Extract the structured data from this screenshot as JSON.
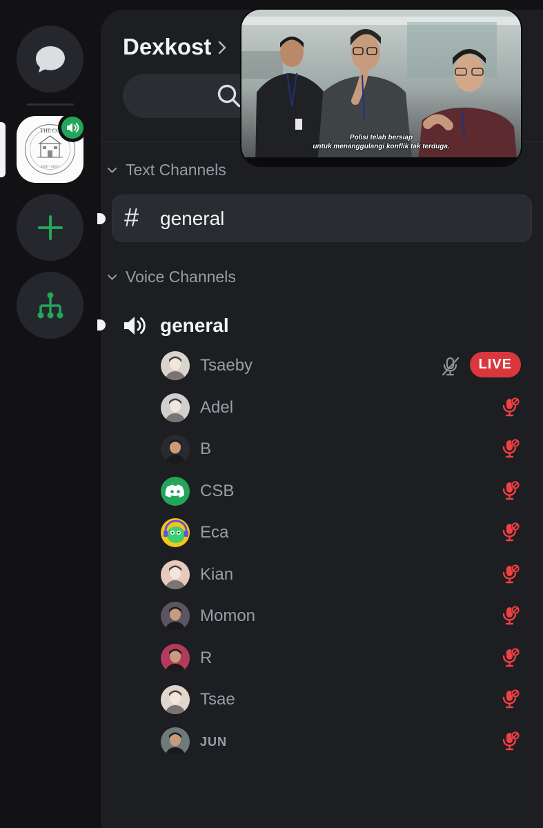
{
  "server": {
    "name": "Dexkost",
    "icon_caption_top": "THE CO",
    "icon_caption_bottom": "EST • 2017"
  },
  "stream_preview": {
    "subtitle_line1": "Polisi telah bersiap",
    "subtitle_line2": "untuk menanggulangi konflik tak terduga."
  },
  "categories": {
    "text": "Text Channels",
    "voice": "Voice Channels"
  },
  "text_channel": {
    "icon": "hash-icon",
    "symbol": "#",
    "name": "general"
  },
  "voice_channel": {
    "icon": "speaker-icon",
    "name": "general"
  },
  "members": [
    {
      "name": "Tsaeby",
      "status": "live",
      "live_label": "LIVE",
      "mic": "muted-grey",
      "avatar_color": "#d9d4cc"
    },
    {
      "name": "Adel",
      "status": "muted",
      "mic": "muted-red",
      "avatar_color": "#cfcfcf"
    },
    {
      "name": "B",
      "status": "muted",
      "mic": "muted-red",
      "avatar_color": "#2a2a2e"
    },
    {
      "name": "CSB",
      "status": "muted",
      "mic": "muted-red",
      "avatar_color": "#23a55a"
    },
    {
      "name": "Eca",
      "status": "muted",
      "mic": "muted-red",
      "avatar_color": "#f5c518"
    },
    {
      "name": "Kian",
      "status": "muted",
      "mic": "muted-red",
      "avatar_color": "#e8c9bd"
    },
    {
      "name": "Momon",
      "status": "muted",
      "mic": "muted-red",
      "avatar_color": "#5a5560"
    },
    {
      "name": "R",
      "status": "muted",
      "mic": "muted-red",
      "avatar_color": "#b23a5c"
    },
    {
      "name": "Tsae",
      "status": "muted",
      "mic": "muted-red",
      "avatar_color": "#e0d6cc"
    },
    {
      "name": "JUN",
      "status": "muted",
      "mic": "muted-red",
      "avatar_color": "#6e7b78"
    }
  ],
  "colors": {
    "accent_green": "#23a55a",
    "live_red": "#da373c",
    "muted_red": "#f23f43",
    "panel_bg": "#1d1e22",
    "rail_bg": "#121214"
  }
}
